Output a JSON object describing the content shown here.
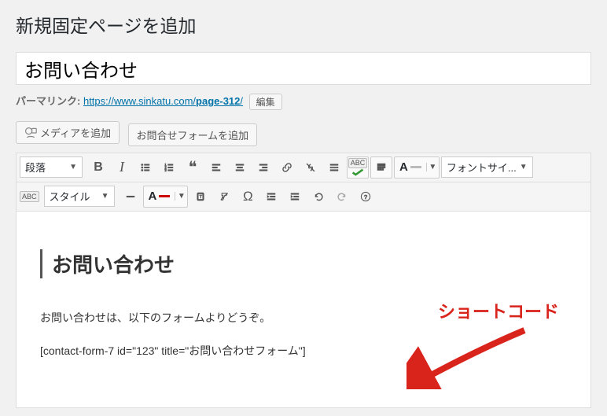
{
  "page": {
    "heading": "新規固定ページを追加",
    "title_value": "お問い合わせ"
  },
  "permalink": {
    "label": "パーマリンク:",
    "base": "https://www.sinkatu.com/",
    "slug": "page-312",
    "trail": "/",
    "edit_label": "編集"
  },
  "buttons": {
    "add_media": "メディアを追加",
    "add_contact_form": "お問合せフォームを追加"
  },
  "toolbar": {
    "paragraph": "段落",
    "style": "スタイル",
    "fontsize": "フォントサイ...",
    "abc": "ABC",
    "abc2": "ABC"
  },
  "editor": {
    "heading": "お問い合わせ",
    "paragraph": "お問い合わせは、以下のフォームよりどうぞ。",
    "shortcode": "[contact-form-7 id=\"123\" title=\"お問い合わせフォーム\"]"
  },
  "annotation": {
    "label": "ショートコード"
  }
}
